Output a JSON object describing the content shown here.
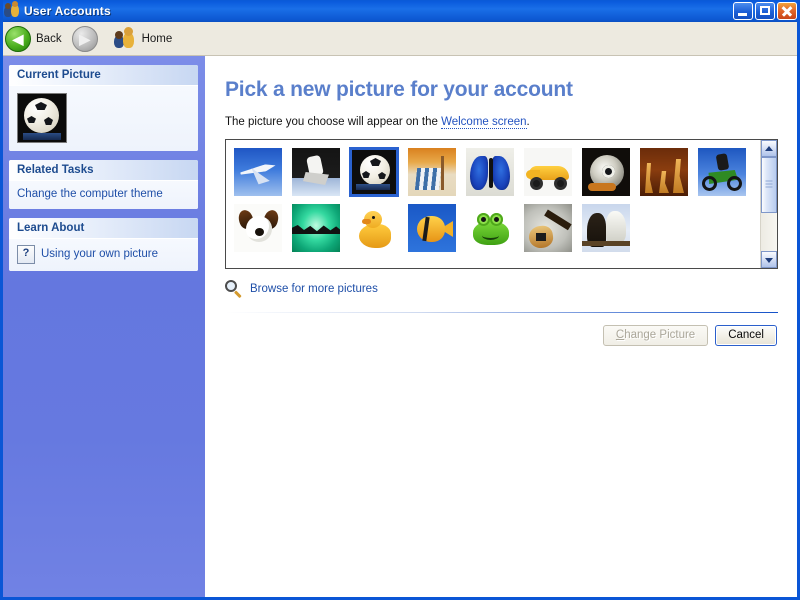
{
  "window": {
    "title": "User Accounts",
    "title_icon": "users-icon",
    "controls": {
      "minimize": "minimize-button",
      "maximize": "maximize-button",
      "close": "close-button"
    }
  },
  "toolbar": {
    "back_label": "Back",
    "back_icon": "back-arrow-icon",
    "forward_icon": "forward-arrow-icon",
    "home_label": "Home",
    "home_icon": "home-users-icon"
  },
  "sidebar": {
    "panels": [
      {
        "title": "Current Picture",
        "type": "picture",
        "picture_alt": "soccer-ball"
      },
      {
        "title": "Related Tasks",
        "type": "links",
        "links": [
          {
            "label": "Change the computer theme"
          }
        ]
      },
      {
        "title": "Learn About",
        "type": "help",
        "links": [
          {
            "label": "Using your own picture",
            "icon": "help-document-icon"
          }
        ]
      }
    ]
  },
  "main": {
    "heading": "Pick a new picture for your account",
    "subtitle_before": "The picture you choose will appear on the ",
    "subtitle_link": "Welcome screen",
    "subtitle_after": ".",
    "pictures": [
      {
        "name": "airplane",
        "art": "art-airplane",
        "selected": false
      },
      {
        "name": "motocross",
        "art": "art-moto",
        "selected": false
      },
      {
        "name": "soccer-ball",
        "art": "art-soccer",
        "selected": true
      },
      {
        "name": "beach-chair",
        "art": "art-beach",
        "selected": false
      },
      {
        "name": "butterfly",
        "art": "art-butterfly",
        "selected": false
      },
      {
        "name": "race-car",
        "art": "art-car",
        "selected": false
      },
      {
        "name": "snail",
        "art": "art-snail",
        "selected": false
      },
      {
        "name": "chess",
        "art": "art-chess",
        "selected": false
      },
      {
        "name": "dirt-bike",
        "art": "art-dirtbike",
        "selected": false
      },
      {
        "name": "dog",
        "art": "art-dog",
        "selected": false
      },
      {
        "name": "green-abstract",
        "art": "art-green",
        "selected": false
      },
      {
        "name": "rubber-duck",
        "art": "art-duck",
        "selected": false
      },
      {
        "name": "fish",
        "art": "art-fish",
        "selected": false
      },
      {
        "name": "frog",
        "art": "art-frog",
        "selected": false
      },
      {
        "name": "guitar",
        "art": "art-guitar",
        "selected": false
      },
      {
        "name": "horses",
        "art": "art-horses",
        "selected": false
      }
    ],
    "scrollbar": {
      "thumb_percent": 60,
      "up_icon": "scroll-up-arrow-icon",
      "down_icon": "scroll-down-arrow-icon"
    },
    "browse_label": "Browse for more pictures",
    "browse_icon": "magnifier-icon",
    "buttons": {
      "change_picture": "Change Picture",
      "change_picture_accel": "C",
      "change_picture_enabled": false,
      "cancel": "Cancel",
      "cancel_default": true
    }
  },
  "colors": {
    "titlebar_blue": "#0A59D6",
    "sidebar_blue": "#6477DF",
    "heading_blue": "#5A7FCB",
    "link_blue": "#1F4FA8",
    "selection_blue": "#2A62D0"
  }
}
